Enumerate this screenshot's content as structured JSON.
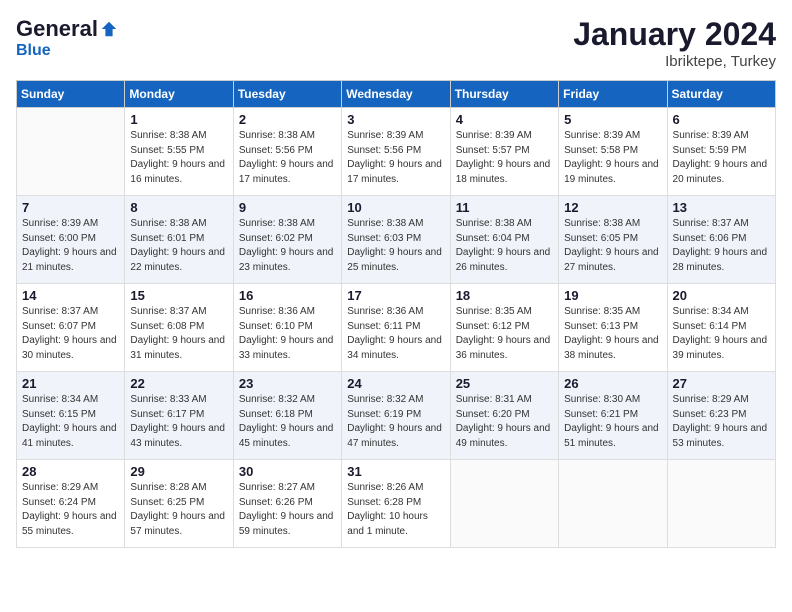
{
  "header": {
    "logo_general": "General",
    "logo_blue": "Blue",
    "month": "January 2024",
    "location": "Ibriktepe, Turkey"
  },
  "weekdays": [
    "Sunday",
    "Monday",
    "Tuesday",
    "Wednesday",
    "Thursday",
    "Friday",
    "Saturday"
  ],
  "weeks": [
    [
      {
        "day": "",
        "sunrise": "",
        "sunset": "",
        "daylight": ""
      },
      {
        "day": "1",
        "sunrise": "Sunrise: 8:38 AM",
        "sunset": "Sunset: 5:55 PM",
        "daylight": "Daylight: 9 hours and 16 minutes."
      },
      {
        "day": "2",
        "sunrise": "Sunrise: 8:38 AM",
        "sunset": "Sunset: 5:56 PM",
        "daylight": "Daylight: 9 hours and 17 minutes."
      },
      {
        "day": "3",
        "sunrise": "Sunrise: 8:39 AM",
        "sunset": "Sunset: 5:56 PM",
        "daylight": "Daylight: 9 hours and 17 minutes."
      },
      {
        "day": "4",
        "sunrise": "Sunrise: 8:39 AM",
        "sunset": "Sunset: 5:57 PM",
        "daylight": "Daylight: 9 hours and 18 minutes."
      },
      {
        "day": "5",
        "sunrise": "Sunrise: 8:39 AM",
        "sunset": "Sunset: 5:58 PM",
        "daylight": "Daylight: 9 hours and 19 minutes."
      },
      {
        "day": "6",
        "sunrise": "Sunrise: 8:39 AM",
        "sunset": "Sunset: 5:59 PM",
        "daylight": "Daylight: 9 hours and 20 minutes."
      }
    ],
    [
      {
        "day": "7",
        "sunrise": "Sunrise: 8:39 AM",
        "sunset": "Sunset: 6:00 PM",
        "daylight": "Daylight: 9 hours and 21 minutes."
      },
      {
        "day": "8",
        "sunrise": "Sunrise: 8:38 AM",
        "sunset": "Sunset: 6:01 PM",
        "daylight": "Daylight: 9 hours and 22 minutes."
      },
      {
        "day": "9",
        "sunrise": "Sunrise: 8:38 AM",
        "sunset": "Sunset: 6:02 PM",
        "daylight": "Daylight: 9 hours and 23 minutes."
      },
      {
        "day": "10",
        "sunrise": "Sunrise: 8:38 AM",
        "sunset": "Sunset: 6:03 PM",
        "daylight": "Daylight: 9 hours and 25 minutes."
      },
      {
        "day": "11",
        "sunrise": "Sunrise: 8:38 AM",
        "sunset": "Sunset: 6:04 PM",
        "daylight": "Daylight: 9 hours and 26 minutes."
      },
      {
        "day": "12",
        "sunrise": "Sunrise: 8:38 AM",
        "sunset": "Sunset: 6:05 PM",
        "daylight": "Daylight: 9 hours and 27 minutes."
      },
      {
        "day": "13",
        "sunrise": "Sunrise: 8:37 AM",
        "sunset": "Sunset: 6:06 PM",
        "daylight": "Daylight: 9 hours and 28 minutes."
      }
    ],
    [
      {
        "day": "14",
        "sunrise": "Sunrise: 8:37 AM",
        "sunset": "Sunset: 6:07 PM",
        "daylight": "Daylight: 9 hours and 30 minutes."
      },
      {
        "day": "15",
        "sunrise": "Sunrise: 8:37 AM",
        "sunset": "Sunset: 6:08 PM",
        "daylight": "Daylight: 9 hours and 31 minutes."
      },
      {
        "day": "16",
        "sunrise": "Sunrise: 8:36 AM",
        "sunset": "Sunset: 6:10 PM",
        "daylight": "Daylight: 9 hours and 33 minutes."
      },
      {
        "day": "17",
        "sunrise": "Sunrise: 8:36 AM",
        "sunset": "Sunset: 6:11 PM",
        "daylight": "Daylight: 9 hours and 34 minutes."
      },
      {
        "day": "18",
        "sunrise": "Sunrise: 8:35 AM",
        "sunset": "Sunset: 6:12 PM",
        "daylight": "Daylight: 9 hours and 36 minutes."
      },
      {
        "day": "19",
        "sunrise": "Sunrise: 8:35 AM",
        "sunset": "Sunset: 6:13 PM",
        "daylight": "Daylight: 9 hours and 38 minutes."
      },
      {
        "day": "20",
        "sunrise": "Sunrise: 8:34 AM",
        "sunset": "Sunset: 6:14 PM",
        "daylight": "Daylight: 9 hours and 39 minutes."
      }
    ],
    [
      {
        "day": "21",
        "sunrise": "Sunrise: 8:34 AM",
        "sunset": "Sunset: 6:15 PM",
        "daylight": "Daylight: 9 hours and 41 minutes."
      },
      {
        "day": "22",
        "sunrise": "Sunrise: 8:33 AM",
        "sunset": "Sunset: 6:17 PM",
        "daylight": "Daylight: 9 hours and 43 minutes."
      },
      {
        "day": "23",
        "sunrise": "Sunrise: 8:32 AM",
        "sunset": "Sunset: 6:18 PM",
        "daylight": "Daylight: 9 hours and 45 minutes."
      },
      {
        "day": "24",
        "sunrise": "Sunrise: 8:32 AM",
        "sunset": "Sunset: 6:19 PM",
        "daylight": "Daylight: 9 hours and 47 minutes."
      },
      {
        "day": "25",
        "sunrise": "Sunrise: 8:31 AM",
        "sunset": "Sunset: 6:20 PM",
        "daylight": "Daylight: 9 hours and 49 minutes."
      },
      {
        "day": "26",
        "sunrise": "Sunrise: 8:30 AM",
        "sunset": "Sunset: 6:21 PM",
        "daylight": "Daylight: 9 hours and 51 minutes."
      },
      {
        "day": "27",
        "sunrise": "Sunrise: 8:29 AM",
        "sunset": "Sunset: 6:23 PM",
        "daylight": "Daylight: 9 hours and 53 minutes."
      }
    ],
    [
      {
        "day": "28",
        "sunrise": "Sunrise: 8:29 AM",
        "sunset": "Sunset: 6:24 PM",
        "daylight": "Daylight: 9 hours and 55 minutes."
      },
      {
        "day": "29",
        "sunrise": "Sunrise: 8:28 AM",
        "sunset": "Sunset: 6:25 PM",
        "daylight": "Daylight: 9 hours and 57 minutes."
      },
      {
        "day": "30",
        "sunrise": "Sunrise: 8:27 AM",
        "sunset": "Sunset: 6:26 PM",
        "daylight": "Daylight: 9 hours and 59 minutes."
      },
      {
        "day": "31",
        "sunrise": "Sunrise: 8:26 AM",
        "sunset": "Sunset: 6:28 PM",
        "daylight": "Daylight: 10 hours and 1 minute."
      },
      {
        "day": "",
        "sunrise": "",
        "sunset": "",
        "daylight": ""
      },
      {
        "day": "",
        "sunrise": "",
        "sunset": "",
        "daylight": ""
      },
      {
        "day": "",
        "sunrise": "",
        "sunset": "",
        "daylight": ""
      }
    ]
  ]
}
